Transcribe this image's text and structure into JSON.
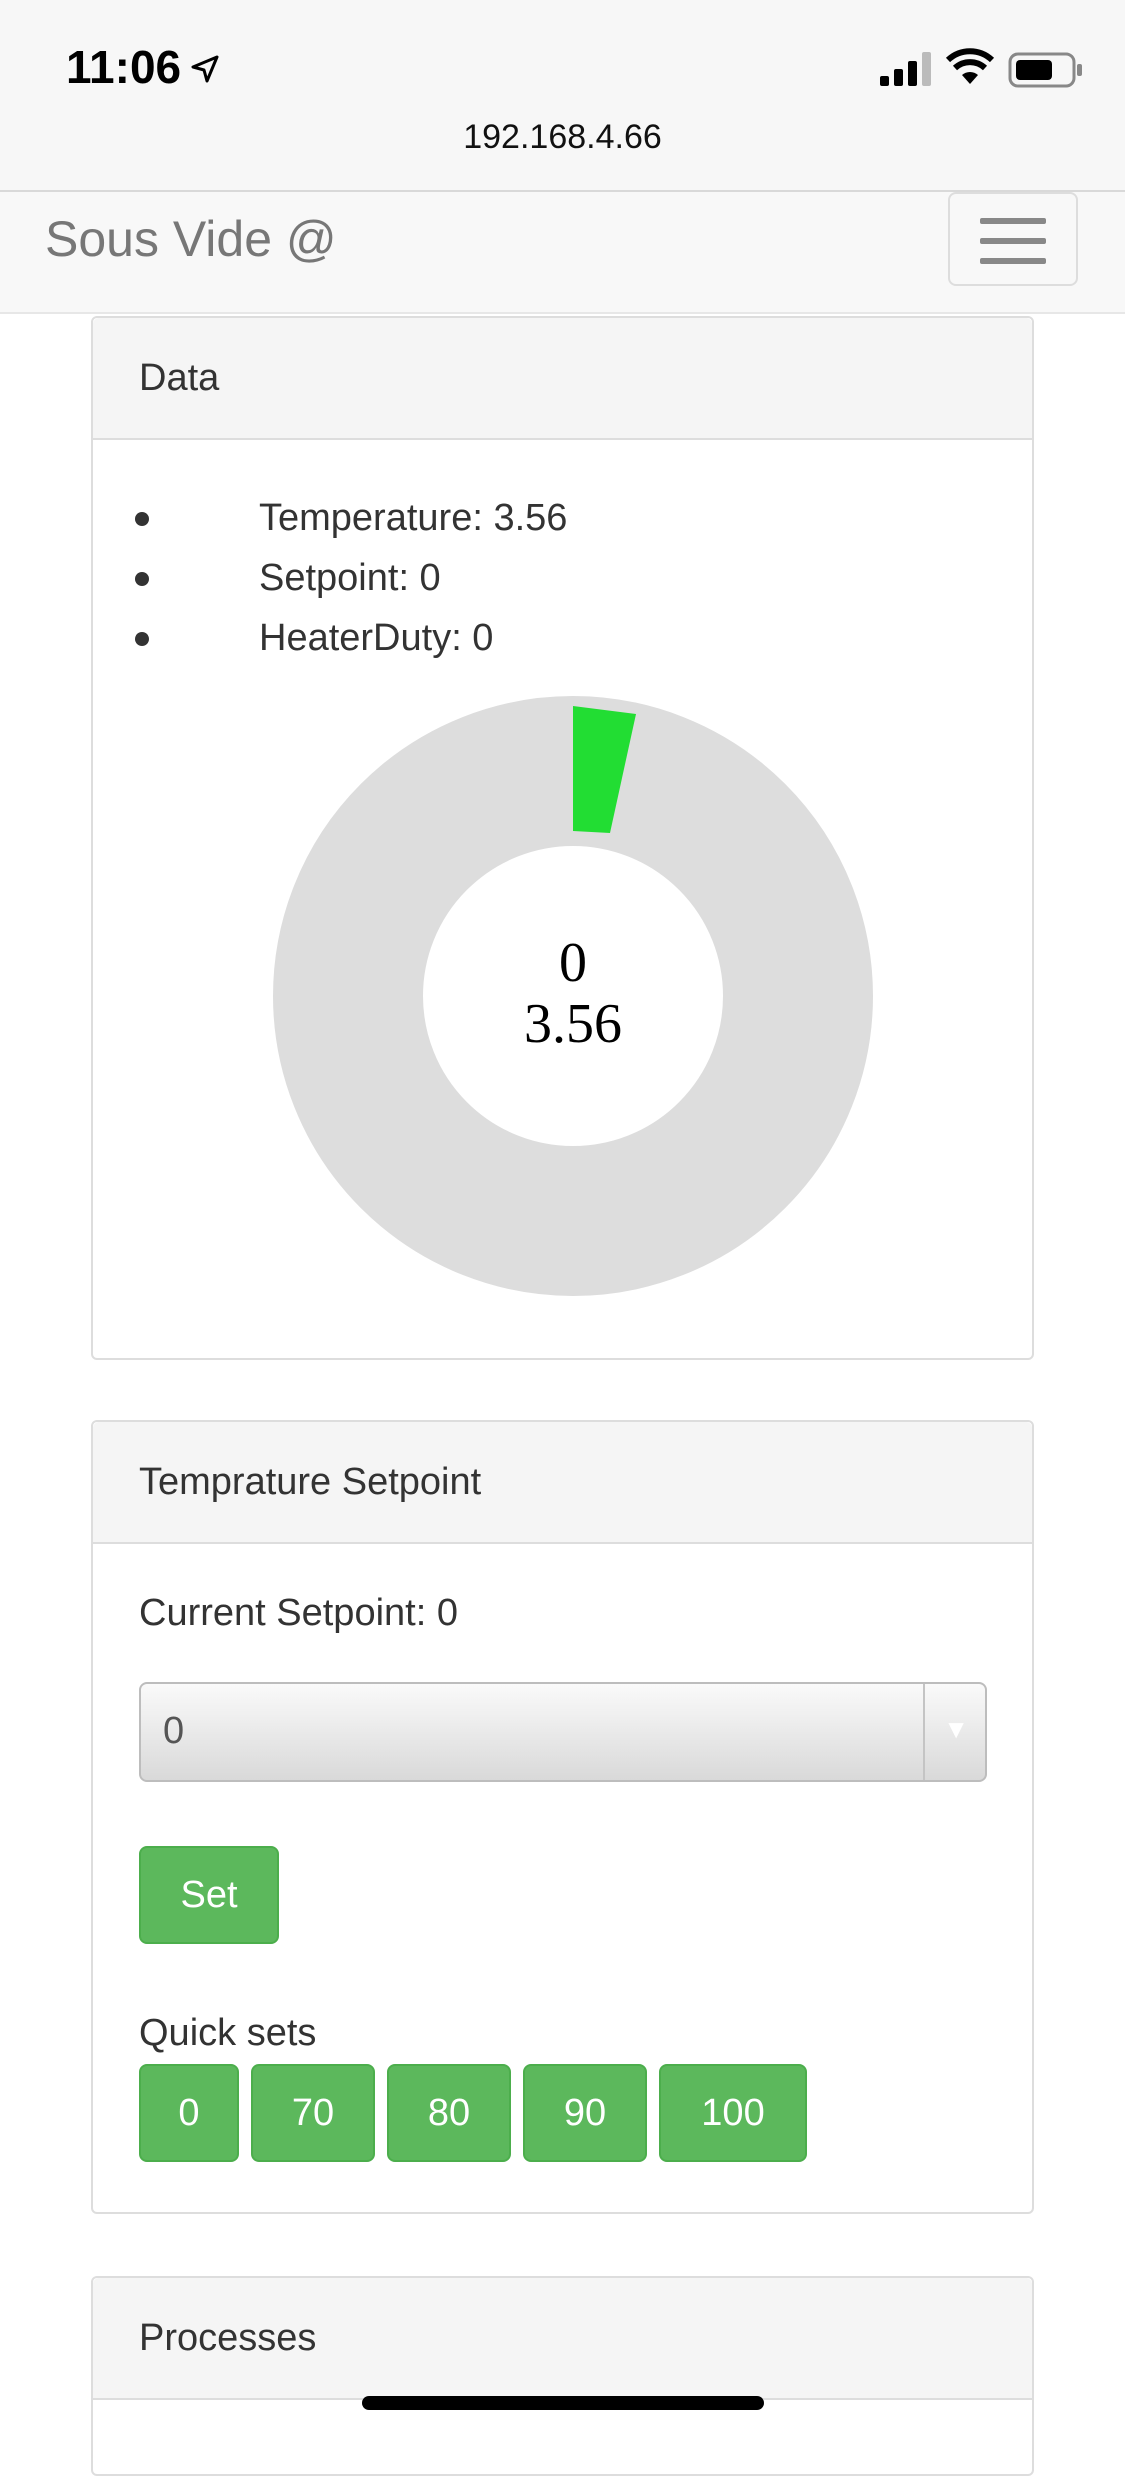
{
  "status_bar": {
    "time": "11:06",
    "url": "192.168.4.66",
    "icons": [
      "location-arrow-icon",
      "cellular-signal-icon",
      "wifi-icon",
      "battery-icon"
    ]
  },
  "navbar": {
    "brand": "Sous Vide @",
    "toggle_icon": "hamburger-menu-icon"
  },
  "data_panel": {
    "heading": "Data",
    "items": [
      "Temperature: 3.56",
      "Setpoint: 0",
      "HeaterDuty: 0"
    ],
    "gauge": {
      "setpoint_text": "0",
      "temperature_text": "3.56",
      "ring_color": "#dddddd",
      "indicator_color": "#22dd33"
    }
  },
  "setpoint_panel": {
    "heading": "Temprature Setpoint",
    "current_label": "Current Setpoint: 0",
    "select_value": "0",
    "set_button": "Set",
    "quick_label": "Quick sets",
    "quick_buttons": [
      "0",
      "70",
      "80",
      "90",
      "100"
    ]
  },
  "processes_panel": {
    "heading": "Processes"
  },
  "colors": {
    "button_green": "#5cb85c",
    "panel_heading_bg": "#f5f5f5"
  }
}
